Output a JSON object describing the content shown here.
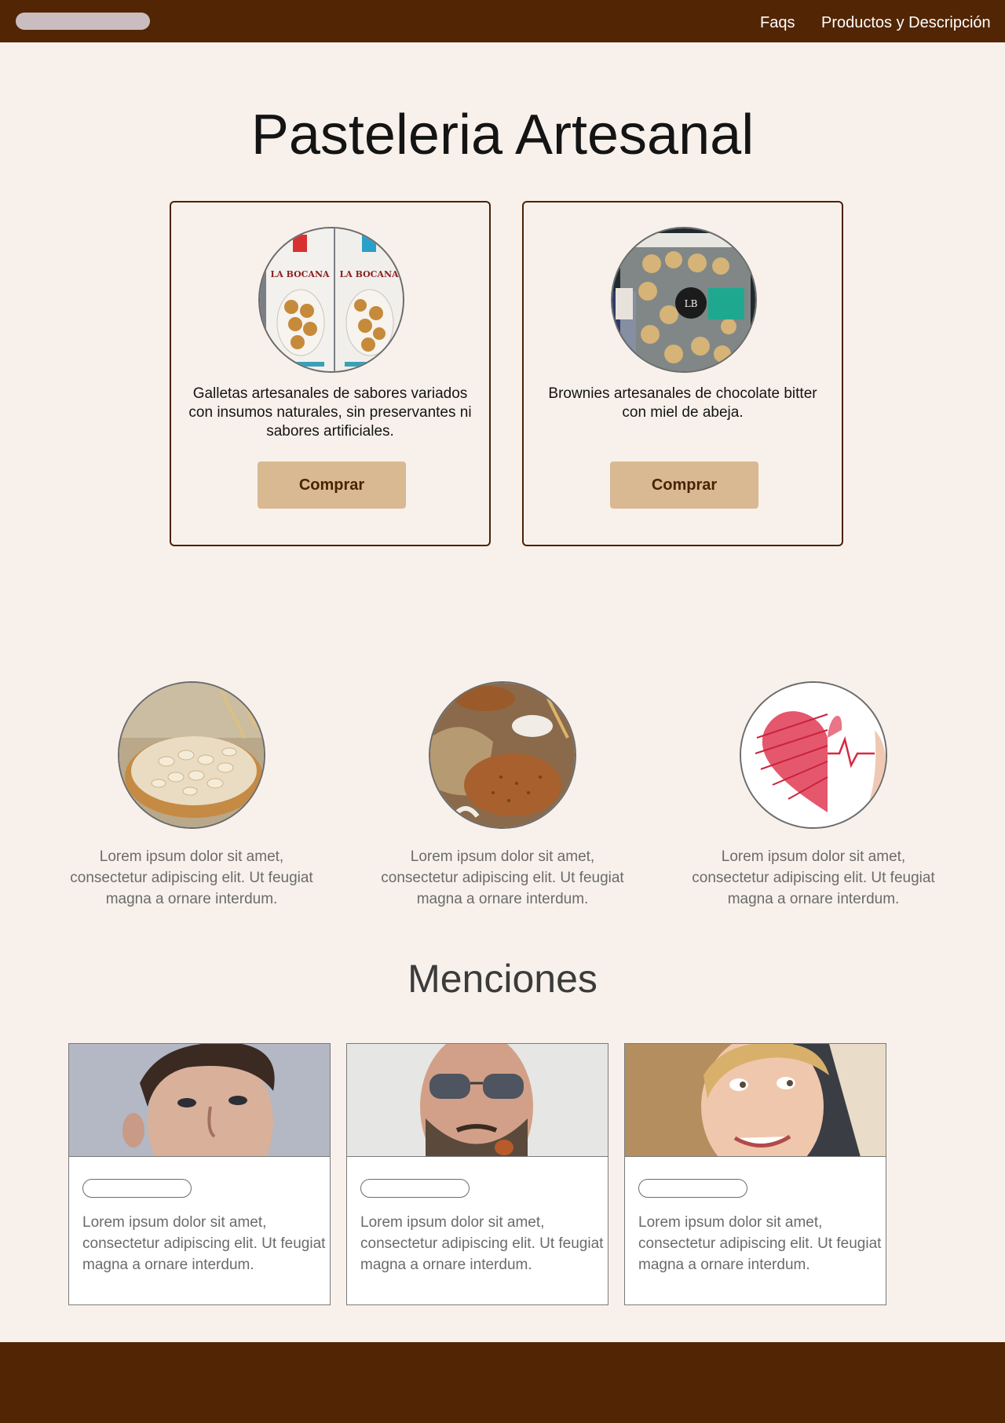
{
  "nav": {
    "links": [
      "Faqs",
      "Productos y Descripción"
    ]
  },
  "hero": {
    "title": "Pasteleria Artesanal"
  },
  "products": [
    {
      "image_icon": "cookie-bags-photo",
      "description": "Galletas artesanales de sabores variados con insumos naturales, sin preservantes ni sabores artificiales.",
      "button_label": "Comprar",
      "packaging_text": "LA BOCANA"
    },
    {
      "image_icon": "cookie-jar-photo",
      "description": "Brownies artesanales de chocolate bitter con miel de abeja.",
      "button_label": "Comprar",
      "packaging_text": "LB"
    }
  ],
  "features": [
    {
      "image_icon": "oats-bowl-photo",
      "text": "Lorem ipsum dolor sit amet, consectetur adipiscing elit. Ut feugiat magna a ornare interdum."
    },
    {
      "image_icon": "flour-sacks-photo",
      "text": "Lorem ipsum dolor sit amet, consectetur adipiscing elit. Ut feugiat magna a ornare interdum."
    },
    {
      "image_icon": "heart-heartbeat-photo",
      "text": "Lorem ipsum dolor sit amet, consectetur adipiscing elit. Ut feugiat magna a ornare interdum."
    }
  ],
  "mentions": {
    "title": "Menciones",
    "cards": [
      {
        "image_icon": "young-man-photo",
        "text": "Lorem ipsum dolor sit amet, consectetur adipiscing elit. Ut feugiat magna a ornare interdum."
      },
      {
        "image_icon": "bearded-man-sunglasses-photo",
        "text": "Lorem ipsum dolor sit amet, consectetur adipiscing elit. Ut feugiat magna a ornare interdum."
      },
      {
        "image_icon": "smiling-woman-photo",
        "text": "Lorem ipsum dolor sit amet, consectetur adipiscing elit. Ut feugiat magna a ornare interdum."
      }
    ]
  },
  "colors": {
    "brand_brown": "#522504",
    "background": "#f8f1eb",
    "button_tan": "#d8b991"
  }
}
